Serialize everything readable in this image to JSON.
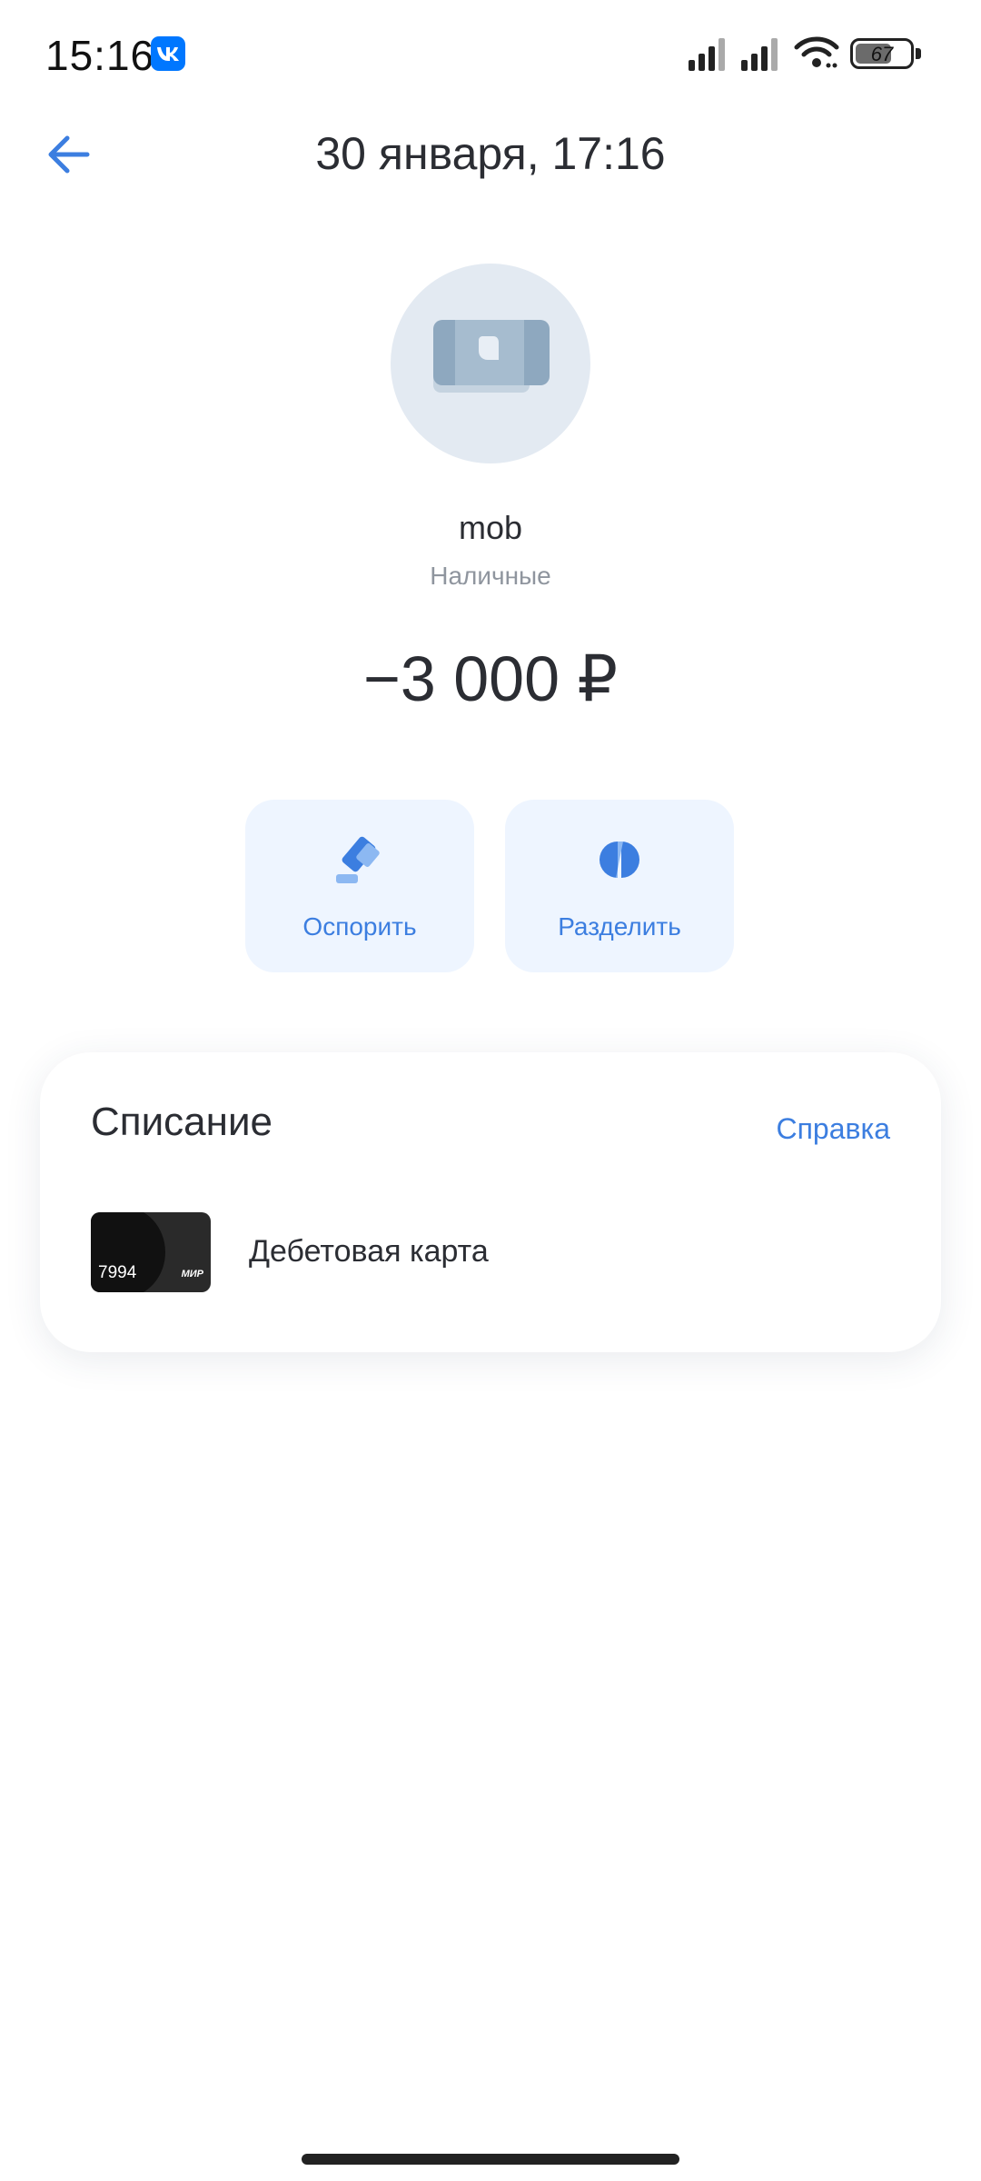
{
  "status_bar": {
    "time": "15:16",
    "app_badge_icon": "vk-icon",
    "battery_level": "67",
    "battery_fraction": 0.67
  },
  "header": {
    "back_icon": "arrow-left-icon",
    "title": "30 января, 17:16"
  },
  "transaction": {
    "merchant_icon": "cash-icon",
    "merchant": "mob",
    "category": "Наличные",
    "amount": "−3 000 ₽"
  },
  "actions": {
    "dispute": {
      "label": "Оспорить",
      "icon": "gavel-icon"
    },
    "split": {
      "label": "Разделить",
      "icon": "split-icon"
    }
  },
  "debit": {
    "title": "Списание",
    "help": "Справка",
    "card_last4": "7994",
    "card_payment_system": "МИР",
    "card_label": "Дебетовая карта"
  },
  "colors": {
    "accent": "#3c7ee0",
    "button_bg": "#eef5ff",
    "avatar_bg": "#e3eaf2",
    "text_primary": "#2b2d33",
    "text_secondary": "#8f959e"
  }
}
